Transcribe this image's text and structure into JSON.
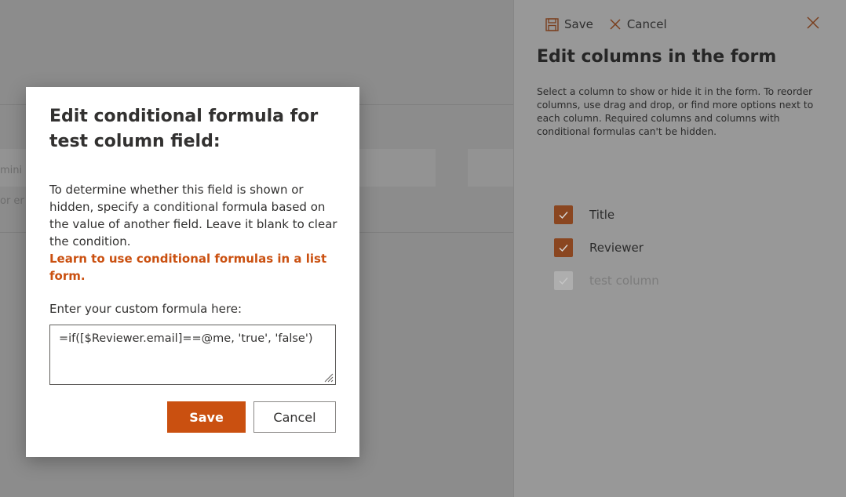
{
  "background": {
    "partial_texts": [
      "mini",
      "or er"
    ]
  },
  "panel": {
    "save_label": "Save",
    "cancel_label": "Cancel",
    "title": "Edit columns in the form",
    "description": "Select a column to show or hide it in the form. To reorder columns, use drag and drop, or find more options next to each column. Required columns and columns with conditional formulas can't be hidden.",
    "columns": [
      {
        "label": "Title",
        "checked": true,
        "disabled": false
      },
      {
        "label": "Reviewer",
        "checked": true,
        "disabled": false
      },
      {
        "label": "test column",
        "checked": true,
        "disabled": true
      }
    ]
  },
  "dialog": {
    "title": "Edit conditional formula for test column field:",
    "body": "To determine whether this field is shown or hidden, specify a conditional formula based on the value of another field. Leave it blank to clear the condition.",
    "link": "Learn to use conditional formulas in a list form.",
    "formula_label": "Enter your custom formula here:",
    "formula_value": "=if([$Reviewer.email]==@me, 'true', 'false')",
    "save_label": "Save",
    "cancel_label": "Cancel"
  },
  "colors": {
    "accent": "#ca5010",
    "checkbox_dim": "#8a4620"
  },
  "icons": [
    "save-icon",
    "cancel-icon",
    "close-icon",
    "checkmark-icon",
    "resize-grip-icon"
  ]
}
